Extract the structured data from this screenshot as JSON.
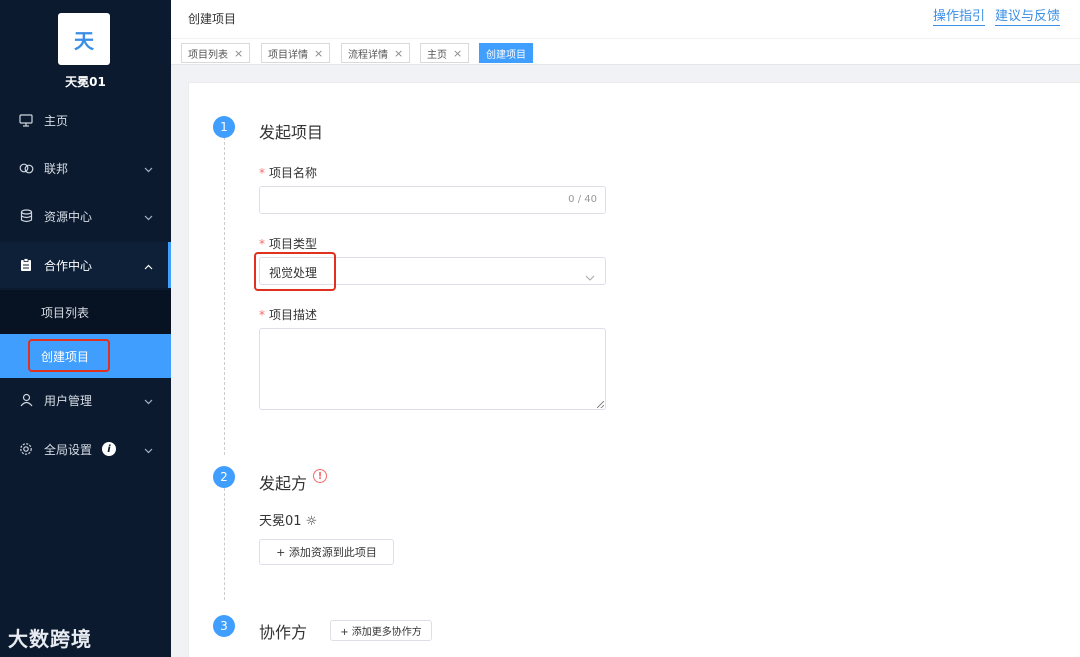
{
  "sidebar": {
    "logo_char": "天",
    "org_name": "天冕01",
    "items": [
      {
        "label": "主页"
      },
      {
        "label": "联邦"
      },
      {
        "label": "资源中心"
      },
      {
        "label": "合作中心"
      },
      {
        "label": "用户管理"
      },
      {
        "label": "全局设置"
      }
    ],
    "sub_items": [
      {
        "label": "项目列表"
      },
      {
        "label": "创建项目"
      }
    ],
    "info_badge": "i",
    "watermark": "大数跨境"
  },
  "header": {
    "title": "创建项目",
    "links": [
      "操作指引",
      "建议与反馈"
    ]
  },
  "tabs": [
    {
      "label": "项目列表"
    },
    {
      "label": "项目详情"
    },
    {
      "label": "流程详情"
    },
    {
      "label": "主页"
    },
    {
      "label": "创建项目"
    }
  ],
  "steps": [
    {
      "num": "1",
      "title": "发起项目"
    },
    {
      "num": "2",
      "title": "发起方"
    },
    {
      "num": "3",
      "title": "协作方"
    }
  ],
  "form": {
    "required_mark": "*",
    "name_label": "项目名称",
    "name_value": "",
    "name_counter": "0 / 40",
    "type_label": "项目类型",
    "type_value": "视觉处理",
    "desc_label": "项目描述",
    "desc_value": ""
  },
  "initiator": {
    "name": "天冕01 ☼",
    "warn_glyph": "!",
    "add_resource_button": "+ 添加资源到此项目"
  },
  "collaborator": {
    "add_button": "+ 添加更多协作方"
  },
  "colors": {
    "accent": "#409eff",
    "sidebar_bg": "#0b1a2e",
    "highlight": "#e0301e",
    "required": "#f56c6c"
  }
}
